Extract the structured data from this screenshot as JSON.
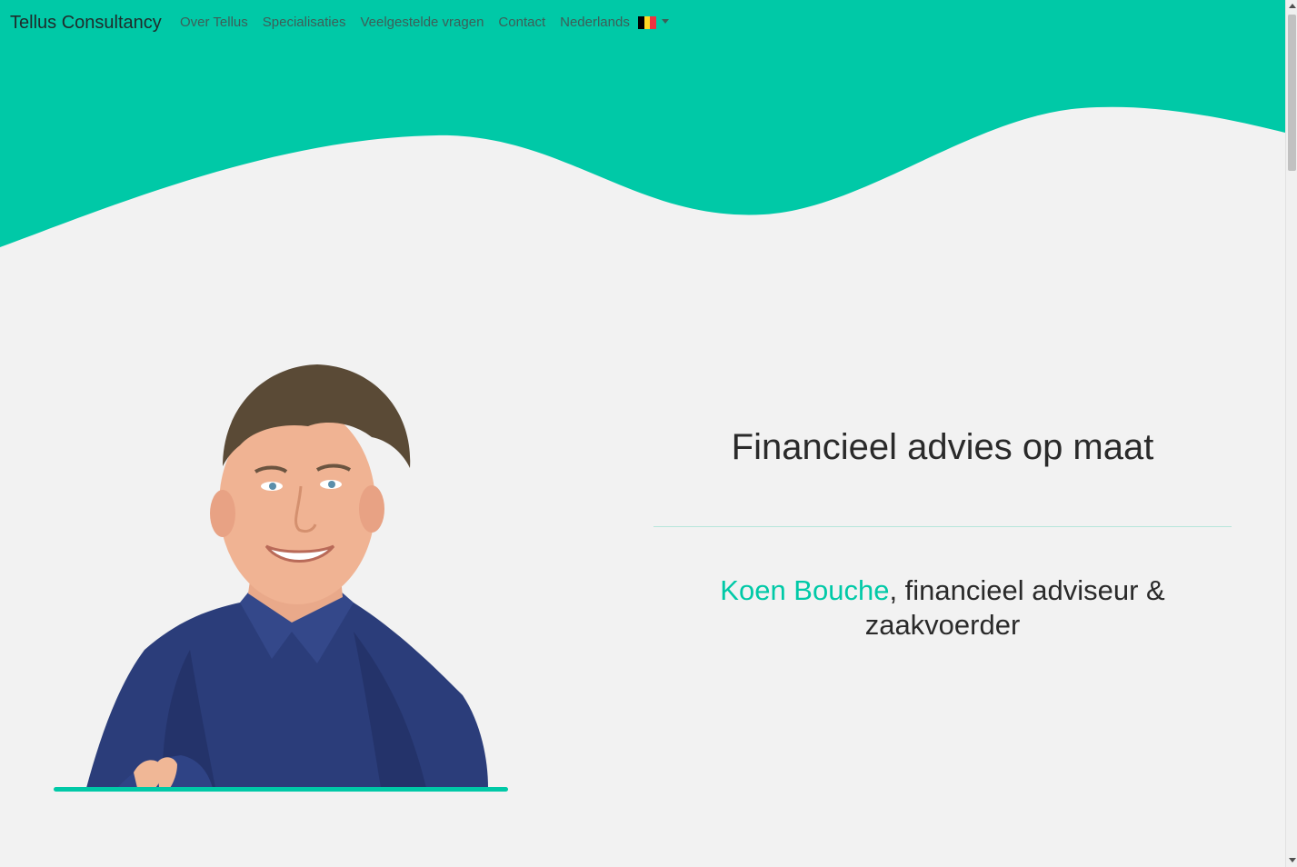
{
  "brand": "Tellus Consultancy",
  "nav": {
    "items": [
      {
        "label": "Over Tellus"
      },
      {
        "label": "Specialisaties"
      },
      {
        "label": "Veelgestelde vragen"
      },
      {
        "label": "Contact"
      }
    ],
    "language": {
      "label": "Nederlands",
      "flag_icon": "belgium-flag-icon",
      "flag_colors": [
        "#000000",
        "#fdda24",
        "#ef3340"
      ]
    }
  },
  "hero": {
    "headline": "Financieel advies op maat",
    "subline_name": "Koen Bouche",
    "subline_rest": ", financieel adviseur & zaakvoerder"
  },
  "colors": {
    "accent": "#00c9a7",
    "background": "#f2f2f2",
    "text": "#2a2a2a"
  }
}
